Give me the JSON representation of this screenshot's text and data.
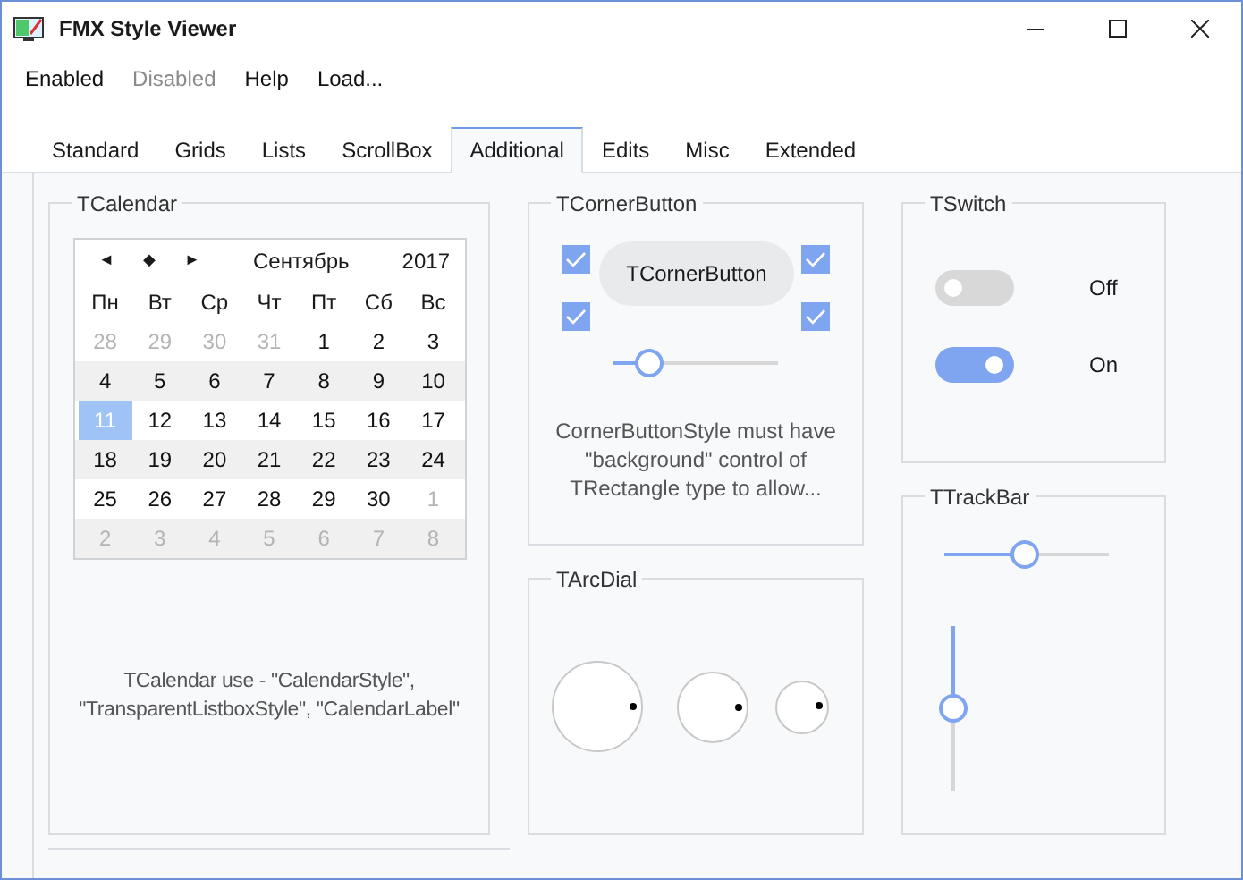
{
  "window": {
    "title": "FMX Style Viewer"
  },
  "menu": [
    {
      "label": "Enabled",
      "disabled": false
    },
    {
      "label": "Disabled",
      "disabled": true
    },
    {
      "label": "Help",
      "disabled": false
    },
    {
      "label": "Load...",
      "disabled": false
    }
  ],
  "tabs": [
    {
      "label": "Standard",
      "selected": false
    },
    {
      "label": "Grids",
      "selected": false
    },
    {
      "label": "Lists",
      "selected": false
    },
    {
      "label": "ScrollBox",
      "selected": false
    },
    {
      "label": "Additional",
      "selected": true
    },
    {
      "label": "Edits",
      "selected": false
    },
    {
      "label": "Misc",
      "selected": false
    },
    {
      "label": "Extended",
      "selected": false
    }
  ],
  "calendar_group": {
    "title": "TCalendar",
    "nav": [
      "◄",
      "◆",
      "►"
    ],
    "month": "Сентябрь",
    "year": "2017",
    "weekdays": [
      "Пн",
      "Вт",
      "Ср",
      "Чт",
      "Пт",
      "Сб",
      "Вс"
    ],
    "weeks": [
      [
        {
          "day": "28",
          "other_month": true,
          "selected": false
        },
        {
          "day": "29",
          "other_month": true,
          "selected": false
        },
        {
          "day": "30",
          "other_month": true,
          "selected": false
        },
        {
          "day": "31",
          "other_month": true,
          "selected": false
        },
        {
          "day": "1",
          "other_month": false,
          "selected": false
        },
        {
          "day": "2",
          "other_month": false,
          "selected": false
        },
        {
          "day": "3",
          "other_month": false,
          "selected": false
        }
      ],
      [
        {
          "day": "4",
          "other_month": false,
          "selected": false
        },
        {
          "day": "5",
          "other_month": false,
          "selected": false
        },
        {
          "day": "6",
          "other_month": false,
          "selected": false
        },
        {
          "day": "7",
          "other_month": false,
          "selected": false
        },
        {
          "day": "8",
          "other_month": false,
          "selected": false
        },
        {
          "day": "9",
          "other_month": false,
          "selected": false
        },
        {
          "day": "10",
          "other_month": false,
          "selected": false
        }
      ],
      [
        {
          "day": "11",
          "other_month": false,
          "selected": true
        },
        {
          "day": "12",
          "other_month": false,
          "selected": false
        },
        {
          "day": "13",
          "other_month": false,
          "selected": false
        },
        {
          "day": "14",
          "other_month": false,
          "selected": false
        },
        {
          "day": "15",
          "other_month": false,
          "selected": false
        },
        {
          "day": "16",
          "other_month": false,
          "selected": false
        },
        {
          "day": "17",
          "other_month": false,
          "selected": false
        }
      ],
      [
        {
          "day": "18",
          "other_month": false,
          "selected": false
        },
        {
          "day": "19",
          "other_month": false,
          "selected": false
        },
        {
          "day": "20",
          "other_month": false,
          "selected": false
        },
        {
          "day": "21",
          "other_month": false,
          "selected": false
        },
        {
          "day": "22",
          "other_month": false,
          "selected": false
        },
        {
          "day": "23",
          "other_month": false,
          "selected": false
        },
        {
          "day": "24",
          "other_month": false,
          "selected": false
        }
      ],
      [
        {
          "day": "25",
          "other_month": false,
          "selected": false
        },
        {
          "day": "26",
          "other_month": false,
          "selected": false
        },
        {
          "day": "27",
          "other_month": false,
          "selected": false
        },
        {
          "day": "28",
          "other_month": false,
          "selected": false
        },
        {
          "day": "29",
          "other_month": false,
          "selected": false
        },
        {
          "day": "30",
          "other_month": false,
          "selected": false
        },
        {
          "day": "1",
          "other_month": true,
          "selected": false
        }
      ],
      [
        {
          "day": "2",
          "other_month": true,
          "selected": false
        },
        {
          "day": "3",
          "other_month": true,
          "selected": false
        },
        {
          "day": "4",
          "other_month": true,
          "selected": false
        },
        {
          "day": "5",
          "other_month": true,
          "selected": false
        },
        {
          "day": "6",
          "other_month": true,
          "selected": false
        },
        {
          "day": "7",
          "other_month": true,
          "selected": false
        },
        {
          "day": "8",
          "other_month": true,
          "selected": false
        }
      ]
    ],
    "note": "TCalendar use - \"CalendarStyle\", \"TransparentListboxStyle\", \"CalendarLabel\""
  },
  "corner_button_group": {
    "title": "TCornerButton",
    "checkboxes": [
      {
        "checked": true
      },
      {
        "checked": true
      },
      {
        "checked": true
      },
      {
        "checked": true
      }
    ],
    "button": "TCornerButton",
    "slider": {
      "level": 0.22
    },
    "note": "CornerButtonStyle must have \"background\" control of TRectangle type to allow..."
  },
  "arc_dial_group": {
    "title": "TArcDial"
  },
  "switch_group": {
    "title": "TSwitch",
    "switches": [
      {
        "label": "Off",
        "on": false
      },
      {
        "label": "On",
        "on": true
      }
    ]
  },
  "trackbar_group": {
    "title": "TTrackBar",
    "horizontal": {
      "level": 0.49
    },
    "vertical": {
      "level": 0.5
    }
  }
}
